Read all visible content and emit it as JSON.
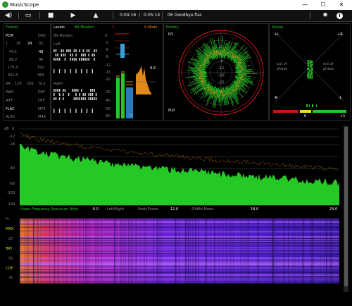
{
  "app": {
    "title": "MusicScope"
  },
  "window": {
    "minimize": "—",
    "maximize": "☐",
    "close": "✕"
  },
  "toolbar": {
    "elapsed": "0:04:16",
    "divider": "/",
    "total": "0:05:14",
    "track": "06 Goodbye.flac"
  },
  "format": {
    "title": "Format",
    "row1": [
      "PCM",
      "DSD"
    ],
    "row2": [
      "1",
      "16",
      "24",
      "32"
    ],
    "rates": [
      [
        "44.1",
        "48"
      ],
      [
        "88.2",
        "96"
      ],
      [
        "176.4",
        "192"
      ],
      [
        "352.8",
        "384"
      ]
    ],
    "dsd": [
      "64",
      "128",
      "256",
      "512"
    ],
    "containers": [
      [
        "WAV",
        "DSF"
      ],
      [
        "AIFF",
        "DFF"
      ],
      [
        "FLAC",
        "MP3"
      ],
      [
        "ALAC",
        "M4A"
      ]
    ]
  },
  "levels": {
    "title": "Levels",
    "bitmonitor": "Bit Monitor",
    "bitmonitor_sub": "Bit Monitor",
    "left": "Left",
    "right": "Right",
    "scale": [
      "0",
      "-3",
      "-6",
      "-9",
      "-12",
      "-15",
      "-20",
      "-30",
      "-40",
      "-50",
      "-60"
    ],
    "peak_value": "9.9",
    "smode": "S-Mode",
    "lu": "LU",
    "marker": "3"
  },
  "history": {
    "title": "History",
    "pl": "P/L",
    "plr": "PLR",
    "rings": [
      "0",
      "-4",
      "-8",
      "-12",
      "-16",
      "-20"
    ]
  },
  "stereo": {
    "title": "Stereo",
    "plus_l": "+L",
    "plus_r": "+R",
    "minus_l": "-L",
    "minus_r": "-R",
    "oop1": "out of phase",
    "oop2": "out of phase",
    "corr_zero": "0",
    "corr_plus": "+1"
  },
  "spectrum": {
    "db_label": "dB",
    "db_ticks": [
      "0",
      "-12",
      "-24",
      "-40",
      "-60",
      "-100",
      "-144"
    ],
    "mode": "Linear Frequency Spectrum (kHz)",
    "lr": "Left/Right",
    "pp": "Peak/Phase",
    "mode2": "-20dBd Mode",
    "freq_ticks": [
      "6.0",
      "12.0",
      "18.0",
      "24.0"
    ]
  },
  "spectrogram": {
    "pct": "%",
    "ticks": [
      "MAX",
      "25",
      "BRY",
      "50",
      "COF",
      "75"
    ]
  },
  "colors": {
    "accent_green": "#26c826",
    "accent_orange": "#e08a1e",
    "accent_red": "#d02020",
    "spectro_purple": "#5a1fd0"
  }
}
